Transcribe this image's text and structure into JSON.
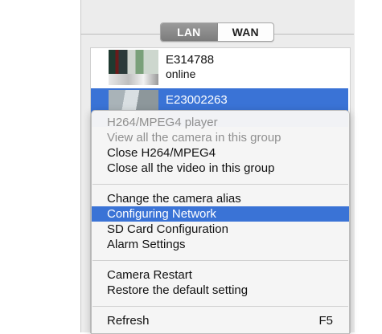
{
  "tabs": [
    {
      "label": "LAN",
      "active": true
    },
    {
      "label": "WAN",
      "active": false
    }
  ],
  "cameras": [
    {
      "name": "E314788",
      "status": "online",
      "selected": false
    },
    {
      "name": "E23002263",
      "status": "",
      "selected": true
    }
  ],
  "context_menu": {
    "items": [
      {
        "label": "H264/MPEG4 player",
        "enabled": false
      },
      {
        "label": "View all the camera in this group",
        "enabled": false
      },
      {
        "label": "Close H264/MPEG4",
        "enabled": true
      },
      {
        "label": "Close all the video in this group",
        "enabled": true
      },
      {
        "label": "Change the camera alias",
        "enabled": true
      },
      {
        "label": "Configuring Network",
        "enabled": true,
        "highlighted": true
      },
      {
        "label": "SD Card Configuration",
        "enabled": true
      },
      {
        "label": "Alarm Settings",
        "enabled": true
      },
      {
        "label": "Camera Restart",
        "enabled": true
      },
      {
        "label": "Restore the default setting",
        "enabled": true
      },
      {
        "label": "Refresh",
        "shortcut": "F5",
        "enabled": true
      }
    ]
  },
  "colors": {
    "selection": "#3a73d6",
    "disabled_text": "#8f8f8f"
  }
}
